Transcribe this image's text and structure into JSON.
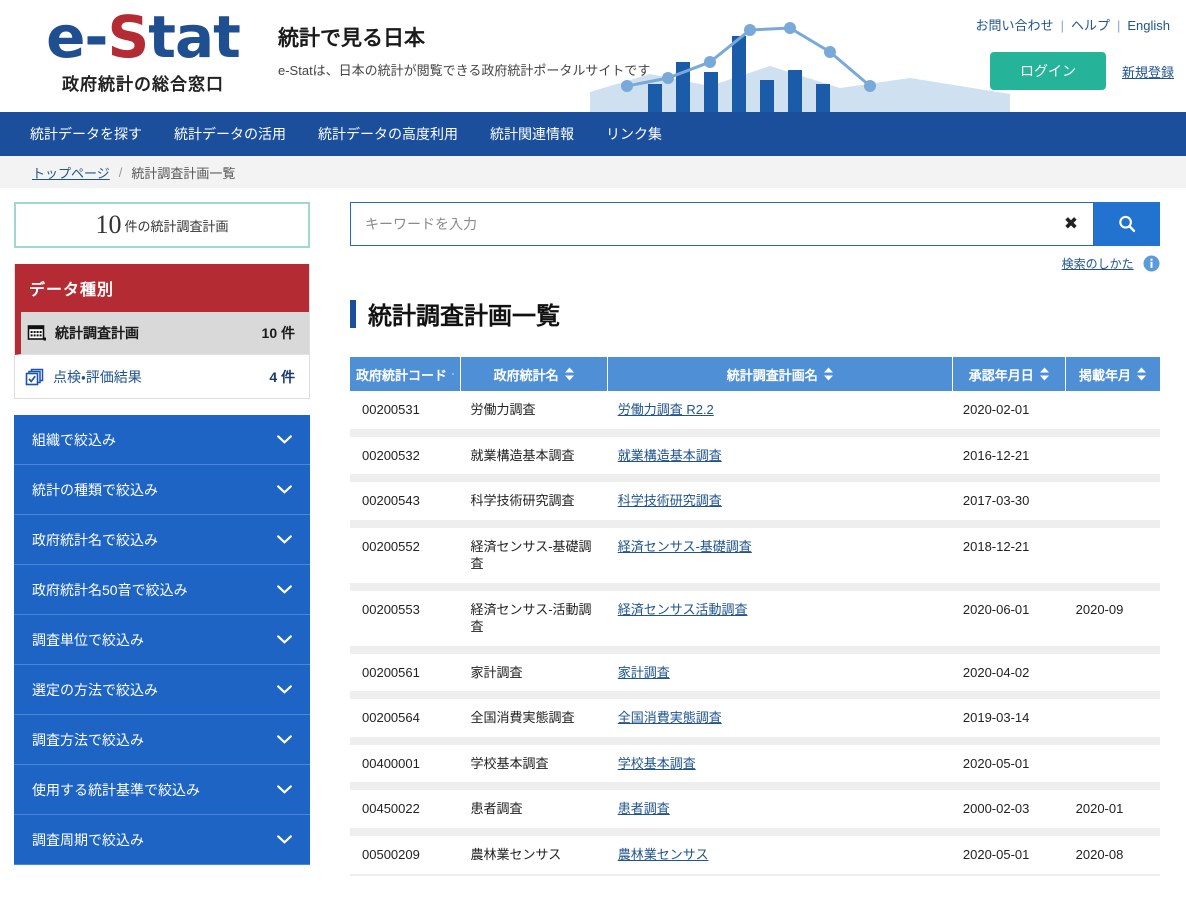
{
  "header": {
    "logo_text": "e-Stat",
    "logo_tagline": "政府統計の総合窓口",
    "title": "統計で見る日本",
    "subtitle": "e-Statは、日本の統計が閲覧できる政府統計ポータルサイトです",
    "links": [
      {
        "label": "お問い合わせ"
      },
      {
        "label": "ヘルプ"
      },
      {
        "label": "English"
      }
    ],
    "login_label": "ログイン",
    "register_label": "新規登録",
    "login_color": "#25b49a",
    "brand_blue": "#1f4e91",
    "brand_red": "#b52b33"
  },
  "global_nav": {
    "items": [
      {
        "label": "統計データを探す"
      },
      {
        "label": "統計データの活用"
      },
      {
        "label": "統計データの高度利用"
      },
      {
        "label": "統計関連情報"
      },
      {
        "label": "リンク集"
      }
    ]
  },
  "breadcrumb": {
    "home": "トップページ",
    "separator": "/",
    "current": "統計調査計画一覧"
  },
  "sidebar": {
    "count_box": {
      "number": "10",
      "label": "件の統計調査計画"
    },
    "datatype": {
      "heading": "データ種別",
      "items": [
        {
          "icon": "calendar-grid-icon",
          "label": "統計調査計画",
          "count": "10 件",
          "active": true
        },
        {
          "icon": "checked-documents-icon",
          "label": "点検・評価結果",
          "count": "4 件",
          "active": false
        }
      ]
    },
    "filters": [
      {
        "label": "組織で絞込み"
      },
      {
        "label": "統計の種類で絞込み"
      },
      {
        "label": "政府統計名で絞込み"
      },
      {
        "label": "政府統計名50音で絞込み"
      },
      {
        "label": "調査単位で絞込み"
      },
      {
        "label": "選定の方法で絞込み"
      },
      {
        "label": "調査方法で絞込み"
      },
      {
        "label": "使用する統計基準で絞込み"
      },
      {
        "label": "調査周期で絞込み"
      }
    ]
  },
  "search": {
    "placeholder": "キーワードを入力",
    "value": "",
    "clear_glyph": "✖",
    "help_label": "検索のしかた"
  },
  "main": {
    "page_title": "統計調査計画一覧",
    "table": {
      "columns": [
        {
          "label": "政府統計コード",
          "sortable": true
        },
        {
          "label": "政府統計名",
          "sortable": true
        },
        {
          "label": "統計調査計画名",
          "sortable": true
        },
        {
          "label": "承認年月日",
          "sortable": true
        },
        {
          "label": "掲載年月",
          "sortable": true
        }
      ],
      "rows": [
        {
          "code": "00200531",
          "name": "労働力調査",
          "plan": "労働力調査 R2.2",
          "approved": "2020-02-01",
          "published": ""
        },
        {
          "code": "00200532",
          "name": "就業構造基本調査",
          "plan": "就業構造基本調査",
          "approved": "2016-12-21",
          "published": ""
        },
        {
          "code": "00200543",
          "name": "科学技術研究調査",
          "plan": "科学技術研究調査",
          "approved": "2017-03-30",
          "published": ""
        },
        {
          "code": "00200552",
          "name": "経済センサス-基礎調査",
          "plan": "経済センサス-基礎調査",
          "approved": "2018-12-21",
          "published": ""
        },
        {
          "code": "00200553",
          "name": "経済センサス-活動調査",
          "plan": "経済センサス活動調査",
          "approved": "2020-06-01",
          "published": "2020-09"
        },
        {
          "code": "00200561",
          "name": "家計調査",
          "plan": "家計調査",
          "approved": "2020-04-02",
          "published": ""
        },
        {
          "code": "00200564",
          "name": "全国消費実態調査",
          "plan": "全国消費実態調査",
          "approved": "2019-03-14",
          "published": ""
        },
        {
          "code": "00400001",
          "name": "学校基本調査",
          "plan": "学校基本調査",
          "approved": "2020-05-01",
          "published": ""
        },
        {
          "code": "00450022",
          "name": "患者調査",
          "plan": "患者調査",
          "approved": "2000-02-03",
          "published": "2020-01"
        },
        {
          "code": "00500209",
          "name": "農林業センサス",
          "plan": "農林業センサス",
          "approved": "2020-05-01",
          "published": "2020-08"
        }
      ]
    }
  }
}
